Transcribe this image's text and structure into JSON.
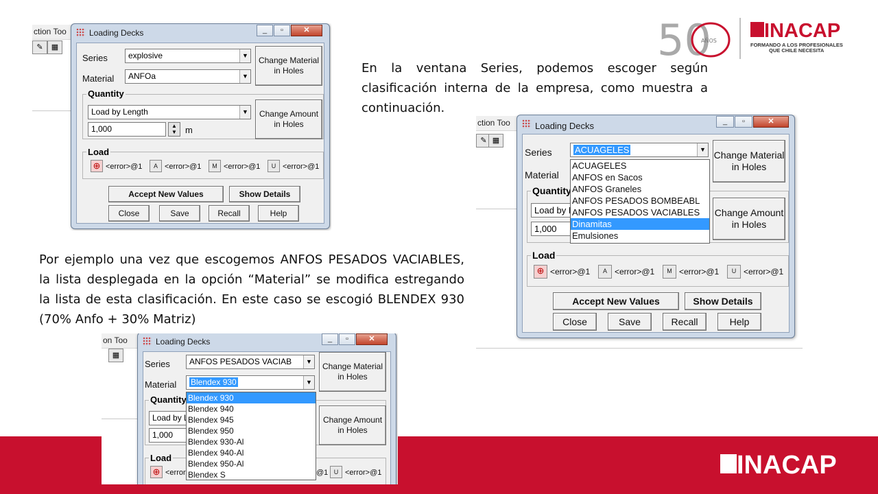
{
  "paragraph1": "En la ventana Series, podemos escoger según clasificación interna de la empresa, como muestra a continuación.",
  "paragraph2": "Por ejemplo una vez que escogemos ANFOS PESADOS VACIABLES, la lista desplegada en la opción “Material” se modifica estregando la lista de esta clasificación. En este caso se escogió BLENDEX 930 (70% Anfo + 30% Matriz)",
  "logo_top": {
    "anniversary_number": "50",
    "anniversary_word": "AÑOS",
    "brand": "INACAP",
    "tagline_line1": "FORMANDO A LOS PROFESIONALES",
    "tagline_line2": "QUE CHILE NECESITA"
  },
  "logo_bottom": {
    "brand": "INACAP"
  },
  "colors": {
    "brand_red": "#c8102e",
    "selection_blue": "#3399ff"
  },
  "dialog": {
    "title": "Loading Decks",
    "bg_menu_1": "ction Too",
    "bg_menu_2": "ction Too",
    "bg_menu_3": "on Too",
    "series_label": "Series",
    "material_label": "Material",
    "change_material_label": "Change Material in Holes",
    "quantity_label": "Quantity",
    "quantity_mode": "Load by Length",
    "quantity_mode_short": "Load by L",
    "quantity_value": "1,000",
    "quantity_unit": "m",
    "change_amount_label": "Change Amount in Holes",
    "load_label": "Load",
    "load_values": [
      "<error>@1",
      "<error>@1",
      "<error>@1",
      "<error>@1"
    ],
    "load_icon_letters": [
      "",
      "A",
      "M",
      "U"
    ],
    "accept_label": "Accept New Values",
    "details_label": "Show Details",
    "close_label": "Close",
    "save_label": "Save",
    "recall_label": "Recall",
    "help_label": "Help"
  },
  "window1": {
    "series_value": "explosive",
    "material_value": "ANFOa"
  },
  "window2": {
    "series_value": "ACUAGELES",
    "series_options": [
      "ACUAGELES",
      "ANFOS en Sacos",
      "ANFOS Graneles",
      "ANFOS PESADOS BOMBEABL",
      "ANFOS PESADOS VACIABLES",
      "Dinamitas",
      "Emulsiones"
    ],
    "highlighted_option": "Dinamitas"
  },
  "window3": {
    "series_value": "ANFOS PESADOS VACIAB",
    "material_value": "Blendex 930",
    "material_options": [
      "Blendex 930",
      "Blendex 940",
      "Blendex 945",
      "Blendex 950",
      "Blendex 930-Al",
      "Blendex 940-Al",
      "Blendex 950-Al",
      "Blendex S"
    ],
    "highlighted_option": "Blendex 930"
  }
}
